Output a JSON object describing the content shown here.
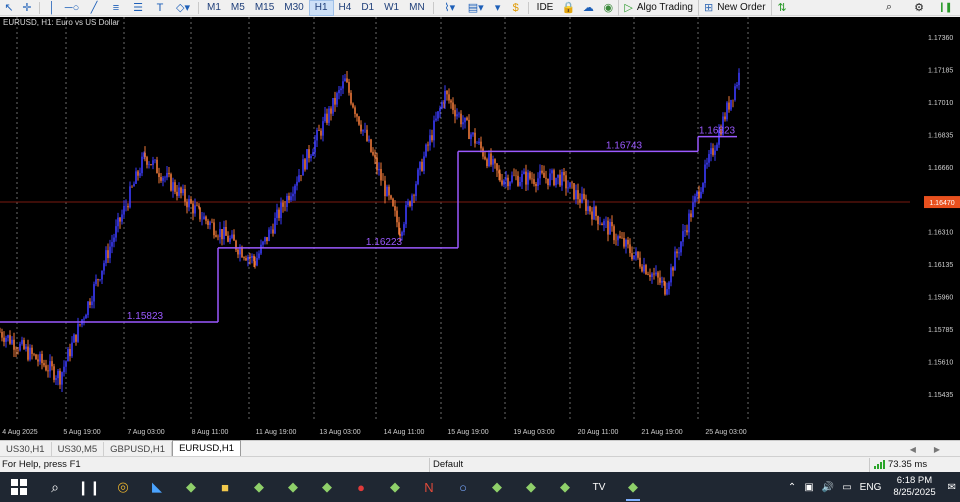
{
  "toolbar": {
    "timeframes": [
      "M1",
      "M5",
      "M15",
      "M30",
      "H1",
      "H4",
      "D1",
      "W1",
      "MN"
    ],
    "active_timeframe": "H1",
    "ide_label": "IDE",
    "algo_trading_label": "Algo Trading",
    "new_order_label": "New Order",
    "tool_icons": [
      "cursor-icon",
      "crosshair-icon",
      "vertical-line-icon",
      "horizontal-line-icon",
      "trendline-icon",
      "channel-icon",
      "text-tool-icon",
      "shapes-icon"
    ]
  },
  "chart": {
    "title": "EURUSD, H1:  Euro vs US Dollar",
    "symbol": "EURUSD",
    "timeframe": "H1",
    "current_price_label": "1.16470",
    "level_labels": [
      "1.15823",
      "1.16223",
      "1.16743",
      "1.16823"
    ],
    "price_axis_labels": [
      "1.17360",
      "1.17185",
      "1.17010",
      "1.16835",
      "1.16660",
      "1.16485",
      "1.16310",
      "1.16135",
      "1.15960",
      "1.15785",
      "1.15610",
      "1.15435"
    ],
    "time_axis_labels": [
      "4 Aug 2025",
      "5 Aug 19:00",
      "7 Aug 03:00",
      "8 Aug 11:00",
      "11 Aug 19:00",
      "13 Aug 03:00",
      "14 Aug 11:00",
      "15 Aug 19:00",
      "19 Aug 03:00",
      "20 Aug 11:00",
      "21 Aug 19:00",
      "25 Aug 03:00"
    ],
    "colors": {
      "background": "#000000",
      "bull_candle": "#3d3dff",
      "bear_candle": "#f07a3a",
      "level_line": "#9b59ff",
      "grid": "#6a6a6a",
      "price_line": "#7a1a10",
      "price_tag": "#e8501e"
    }
  },
  "chart_data": {
    "type": "line",
    "title": "EURUSD, H1:  Euro vs US Dollar",
    "xlabel": "",
    "ylabel": "",
    "ylim": [
      1.1535,
      1.1745
    ],
    "x": [
      "4 Aug 2025",
      "5 Aug 19:00",
      "7 Aug 03:00",
      "8 Aug 11:00",
      "11 Aug 19:00",
      "13 Aug 03:00",
      "14 Aug 11:00",
      "15 Aug 19:00",
      "19 Aug 03:00",
      "20 Aug 11:00",
      "21 Aug 19:00",
      "25 Aug 03:00"
    ],
    "series": [
      {
        "values": [
          1.1577,
          1.1553,
          1.1672,
          1.164,
          1.1615,
          1.1712,
          1.1632,
          1.1705,
          1.166,
          1.166,
          1.1601,
          1.1717
        ]
      }
    ],
    "levels": [
      {
        "label": "1.15823",
        "value": 1.15823,
        "from": "4 Aug 2025",
        "to": "8 Aug 11:00"
      },
      {
        "label": "1.16223",
        "value": 1.16223,
        "from": "8 Aug 11:00",
        "to": "15 Aug 19:00"
      },
      {
        "label": "1.16743",
        "value": 1.16743,
        "from": "15 Aug 19:00",
        "to": "25 Aug 03:00"
      },
      {
        "label": "1.16823",
        "value": 1.16823,
        "from": "25 Aug 03:00",
        "to": "25 Aug 12:00"
      }
    ],
    "current_price": 1.1647,
    "grid": true
  },
  "tabs": {
    "items": [
      "US30,H1",
      "US30,M5",
      "GBPUSD,H1",
      "EURUSD,H1"
    ],
    "active": "EURUSD,H1"
  },
  "status": {
    "help_text": "For Help, press F1",
    "profile": "Default",
    "ping": "73.35 ms"
  },
  "taskbar": {
    "apps": [
      "chrome-icon",
      "app-icon",
      "metatrader-icon",
      "folder-icon",
      "metatrader-icon",
      "metatrader-icon",
      "metatrader-icon",
      "red-app-icon",
      "metatrader-icon",
      "ninjatrader-icon",
      "browser-icon",
      "metatrader-icon",
      "metatrader-icon",
      "metatrader-icon",
      "tradingview-icon",
      "metatrader-icon"
    ],
    "language": "ENG",
    "time": "6:18 PM",
    "date": "8/25/2025"
  }
}
